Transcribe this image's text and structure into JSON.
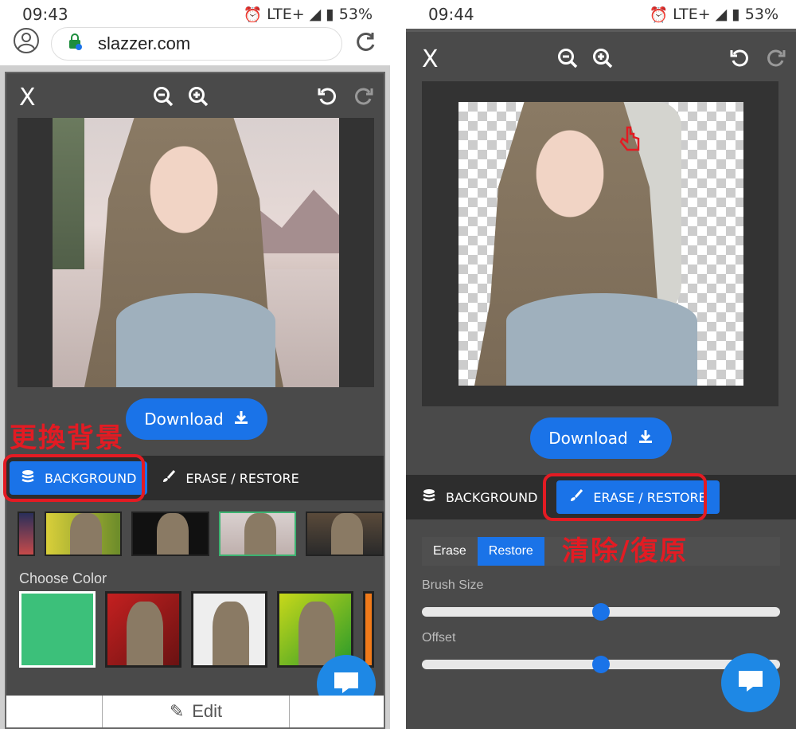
{
  "left": {
    "status": {
      "time": "09:43",
      "network": "LTE+",
      "battery": "53%"
    },
    "browser": {
      "url": "slazzer.com"
    },
    "editor": {
      "close_label": "X",
      "download_label": "Download",
      "tabs": [
        {
          "label": "BACKGROUND",
          "active": true
        },
        {
          "label": "ERASE / RESTORE",
          "active": false
        }
      ],
      "choose_color_label": "Choose Color",
      "swatch_colors": [
        "#3cc07a",
        "#a51e1e",
        "#eeeeee",
        "#7bbd1a",
        "#f07a1a"
      ],
      "bottom_nav_label": "Edit"
    },
    "annotation": "更換背景"
  },
  "right": {
    "status": {
      "time": "09:44",
      "network": "LTE+",
      "battery": "53%"
    },
    "editor": {
      "close_label": "X",
      "download_label": "Download",
      "tabs": [
        {
          "label": "BACKGROUND",
          "active": false
        },
        {
          "label": "ERASE / RESTORE",
          "active": true
        }
      ],
      "modes": [
        {
          "label": "Erase",
          "active": false
        },
        {
          "label": "Restore",
          "active": true
        }
      ],
      "brush_size_label": "Brush Size",
      "brush_size_value": 0.5,
      "offset_label": "Offset",
      "offset_value": 0.5
    },
    "annotation": "清除/復原"
  },
  "colors": {
    "accent": "#1a73e8",
    "annotation_red": "#e31b23",
    "panel": "#4a4a4a",
    "tabbar": "#2d2d2d"
  }
}
